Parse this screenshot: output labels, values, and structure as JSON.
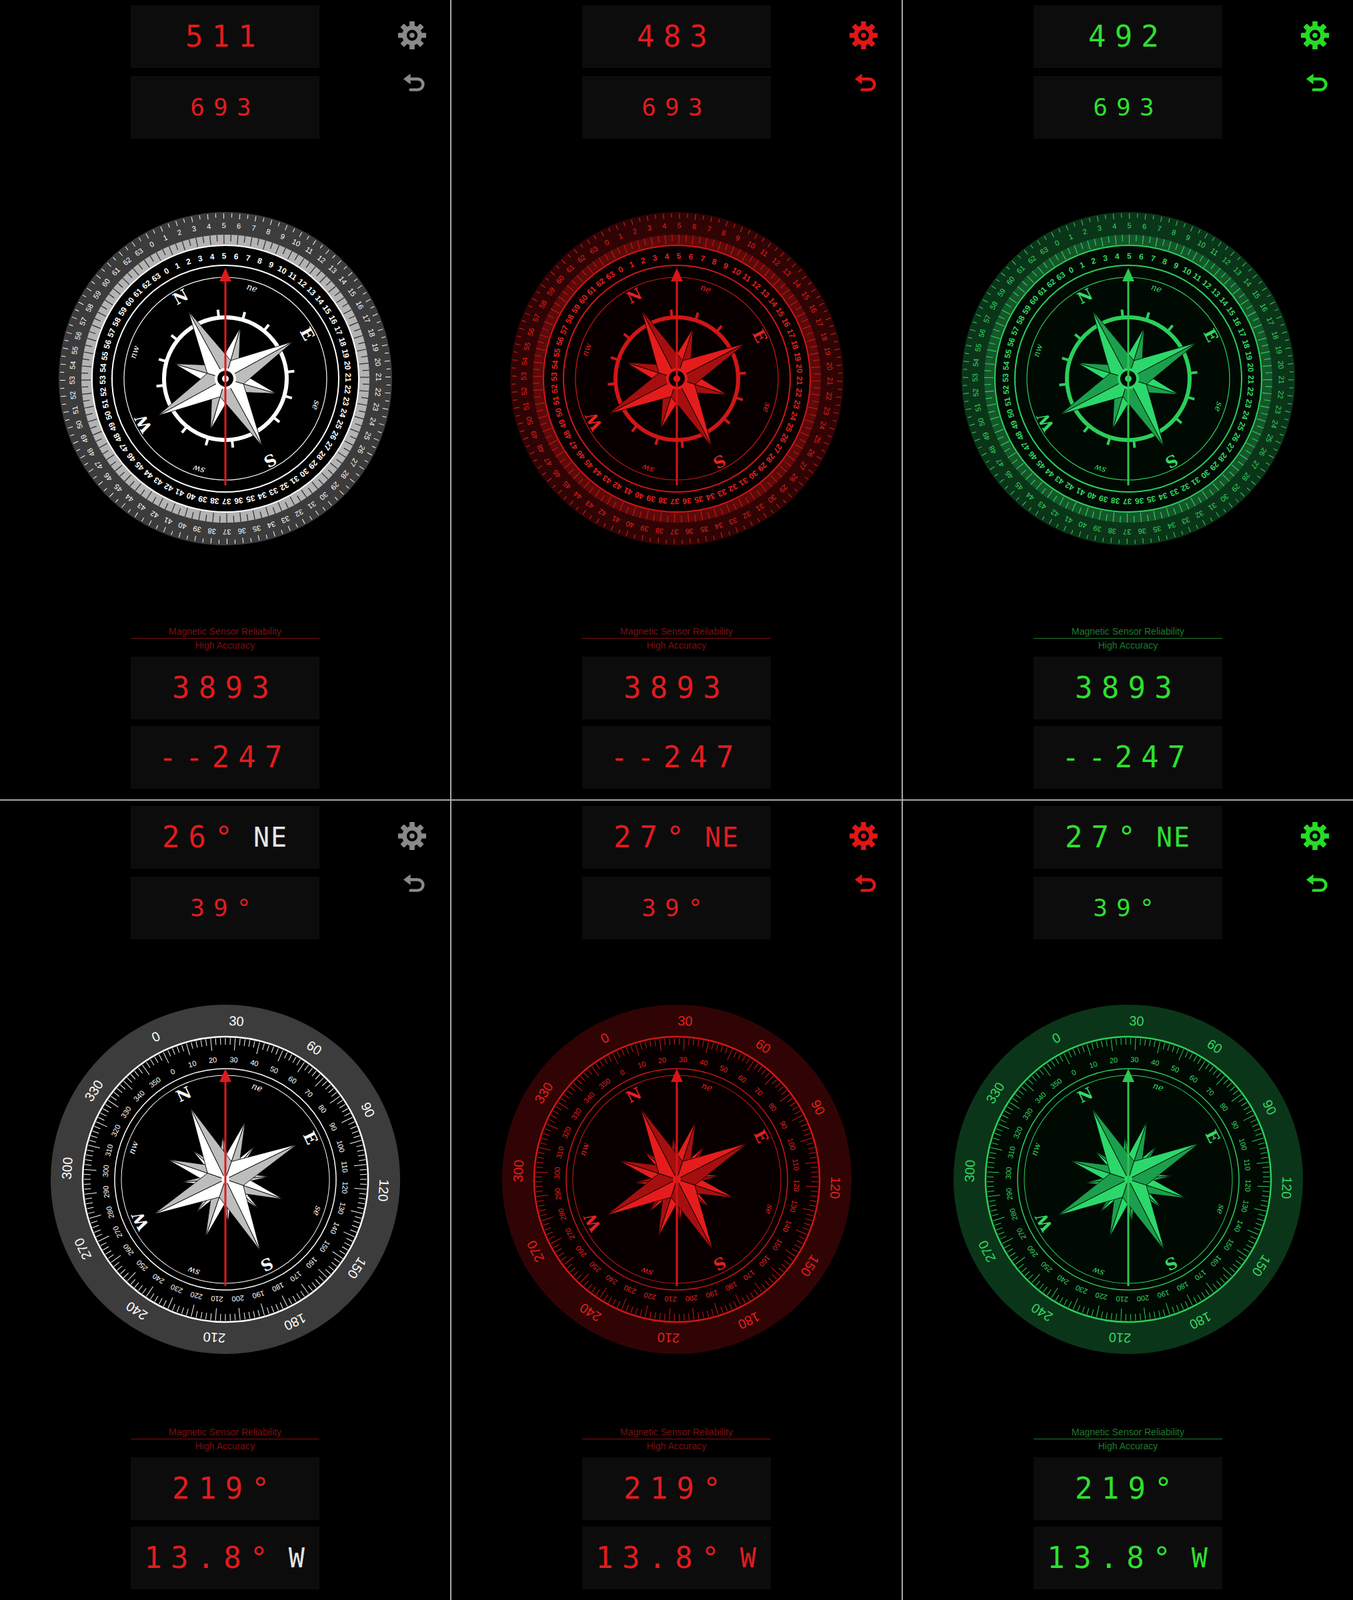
{
  "rows": [
    {
      "dial": {
        "kind": "mils",
        "outer_labels": [
          "0",
          "1",
          "2",
          "3",
          "4",
          "5",
          "6",
          "7",
          "8",
          "9",
          "10",
          "11",
          "12",
          "13",
          "14",
          "15",
          "16",
          "17",
          "18",
          "19",
          "20",
          "21",
          "22",
          "23",
          "24",
          "25",
          "26",
          "27",
          "28",
          "29",
          "30",
          "31",
          "32",
          "33",
          "34",
          "35",
          "36",
          "37",
          "38",
          "39",
          "40",
          "41",
          "42",
          "43",
          "44",
          "45",
          "46",
          "47",
          "48",
          "49",
          "50",
          "51",
          "52",
          "53",
          "54",
          "55",
          "56",
          "57",
          "58",
          "59",
          "60",
          "61",
          "62",
          "63"
        ],
        "inner_labels": [
          "0",
          "1",
          "2",
          "3",
          "4",
          "5",
          "6",
          "7",
          "8",
          "9",
          "10",
          "11",
          "12",
          "13",
          "14",
          "15",
          "16",
          "17",
          "18",
          "19",
          "20",
          "21",
          "22",
          "23",
          "24",
          "25",
          "26",
          "27",
          "28",
          "29",
          "30",
          "31",
          "32",
          "33",
          "34",
          "35",
          "36",
          "37",
          "38",
          "39",
          "40",
          "41",
          "42",
          "43",
          "44",
          "45",
          "46",
          "47",
          "48",
          "49",
          "50",
          "51",
          "52",
          "53",
          "54",
          "55",
          "56",
          "57",
          "58",
          "59",
          "60",
          "61",
          "62",
          "63"
        ],
        "points": [
          "N",
          "ne",
          "E",
          "se",
          "S",
          "sw",
          "W",
          "nw"
        ]
      },
      "panels": [
        {
          "kind": "white",
          "color": "#e31b1e",
          "rotation": -28.7,
          "top": [
            {
              "text": "511"
            },
            {
              "text": "693"
            }
          ],
          "reliability": {
            "title": "Magnetic Sensor Reliability",
            "status": "High Accuracy"
          },
          "bottom": [
            {
              "text": "3893"
            },
            {
              "text": "--247"
            }
          ]
        },
        {
          "kind": "red",
          "color": "#e31b1e",
          "rotation": -27.2,
          "top": [
            {
              "text": "483"
            },
            {
              "text": "693"
            }
          ],
          "reliability": {
            "title": "Magnetic Sensor Reliability",
            "status": "High Accuracy"
          },
          "bottom": [
            {
              "text": "3893"
            },
            {
              "text": "--247"
            }
          ]
        },
        {
          "kind": "green",
          "color": "#2ee02e",
          "rotation": -27.7,
          "top": [
            {
              "text": "492"
            },
            {
              "text": "693"
            }
          ],
          "reliability": {
            "title": "Magnetic Sensor Reliability",
            "status": "High Accuracy"
          },
          "bottom": [
            {
              "text": "3893"
            },
            {
              "text": "--247"
            }
          ]
        }
      ]
    },
    {
      "dial": {
        "kind": "degrees",
        "outer_labels": [
          "0",
          "30",
          "60",
          "90",
          "120",
          "150",
          "180",
          "210",
          "240",
          "270",
          "300",
          "330"
        ],
        "inner_labels": [
          "0",
          "10",
          "20",
          "30",
          "40",
          "50",
          "60",
          "70",
          "80",
          "90",
          "100",
          "110",
          "120",
          "130",
          "140",
          "150",
          "160",
          "170",
          "180",
          "190",
          "200",
          "210",
          "220",
          "230",
          "240",
          "250",
          "260",
          "270",
          "280",
          "290",
          "300",
          "310",
          "320",
          "330",
          "340",
          "350"
        ],
        "points": [
          "N",
          "ne",
          "E",
          "se",
          "S",
          "sw",
          "W",
          "nw"
        ]
      },
      "panels": [
        {
          "kind": "white",
          "color": "#e31b1e",
          "rotation": -26,
          "top": [
            {
              "text": "26°",
              "suffix": "NE"
            },
            {
              "text": "39°"
            }
          ],
          "reliability": {
            "title": "Magnetic Sensor Reliability",
            "status": "High Accuracy"
          },
          "bottom": [
            {
              "text": "219°"
            },
            {
              "text": "13.8°",
              "suffix": "W"
            }
          ]
        },
        {
          "kind": "red",
          "color": "#e31b1e",
          "rotation": -27,
          "top": [
            {
              "text": "27°",
              "suffix": "NE"
            },
            {
              "text": "39°"
            }
          ],
          "reliability": {
            "title": "Magnetic Sensor Reliability",
            "status": "High Accuracy"
          },
          "bottom": [
            {
              "text": "219°"
            },
            {
              "text": "13.8°",
              "suffix": "W"
            }
          ]
        },
        {
          "kind": "green",
          "color": "#2ee02e",
          "rotation": -27,
          "top": [
            {
              "text": "27°",
              "suffix": "NE"
            },
            {
              "text": "39°"
            }
          ],
          "reliability": {
            "title": "Magnetic Sensor Reliability",
            "status": "High Accuracy"
          },
          "bottom": [
            {
              "text": "219°"
            },
            {
              "text": "13.8°",
              "suffix": "W"
            }
          ]
        }
      ]
    }
  ]
}
